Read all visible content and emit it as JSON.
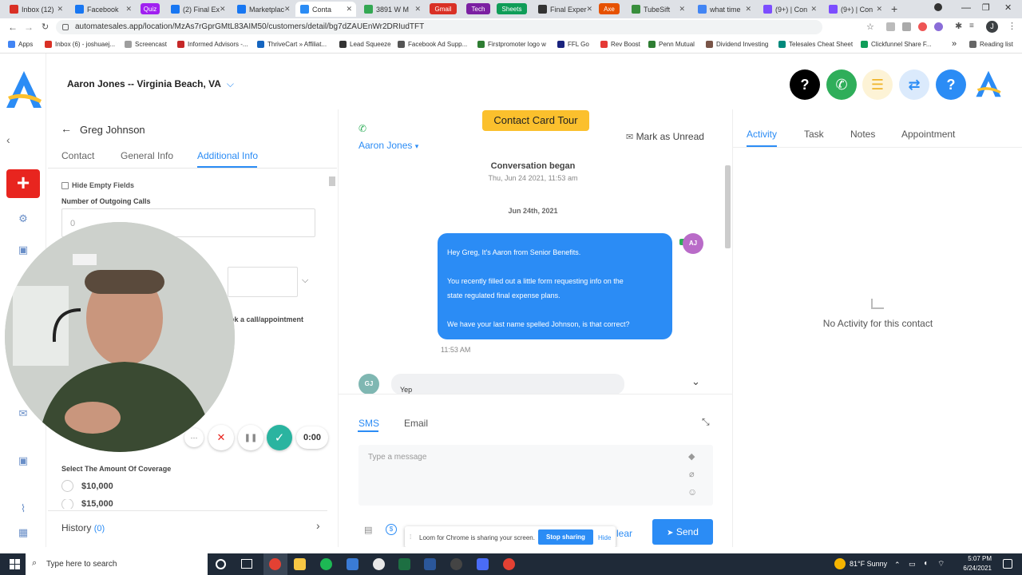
{
  "browser": {
    "tabs": [
      {
        "label": "Inbox (12)",
        "color": "#d93025"
      },
      {
        "label": "Facebook",
        "color": "#1877f2"
      },
      {
        "label": "Quiz",
        "color": "#a020f0",
        "pill": true
      },
      {
        "label": "(2) Final Ex",
        "color": "#1877f2"
      },
      {
        "label": "Marketplac",
        "color": "#1877f2"
      },
      {
        "label": "Conta",
        "color": "#2b8cf5",
        "active": true
      },
      {
        "label": "3891 W M",
        "color": "#34a853"
      },
      {
        "label": "Gmail",
        "color": "#d93025",
        "pill": true
      },
      {
        "label": "Tech",
        "color": "#7b1fa2",
        "pill": true
      },
      {
        "label": "Sheets",
        "color": "#0f9d58",
        "pill": true
      },
      {
        "label": "Final Exper",
        "color": "#333333"
      },
      {
        "label": "Axe",
        "color": "#e65100",
        "pill": true
      },
      {
        "label": "TubeSift",
        "color": "#388e3c"
      },
      {
        "label": "what time",
        "color": "#4285f4"
      },
      {
        "label": "(9+) | Con",
        "color": "#7c4dff"
      },
      {
        "label": "(9+) | Con",
        "color": "#7c4dff"
      }
    ],
    "new_tab_glyph": "+",
    "url": "automatesales.app/location/MzAs7rGprGMtL83AIM50/customers/detail/bg7dZAUEnWr2DRIudTFT",
    "bookmarks": [
      {
        "label": "Apps",
        "color": "#4285f4"
      },
      {
        "label": "Inbox (6) - joshuaej...",
        "color": "#d93025"
      },
      {
        "label": "Screencast",
        "color": "#9e9e9e"
      },
      {
        "label": "Informed Advisors -...",
        "color": "#c62828"
      },
      {
        "label": "ThriveCart » Affiliat...",
        "color": "#1565c0"
      },
      {
        "label": "Lead Squeeze",
        "color": "#333333"
      },
      {
        "label": "Facebook Ad Supp...",
        "color": "#555555"
      },
      {
        "label": "Firstpromoter logo w",
        "color": "#2e7d32"
      },
      {
        "label": "FFL Go",
        "color": "#1a237e"
      },
      {
        "label": "Rev Boost",
        "color": "#e53935"
      },
      {
        "label": "Penn Mutual",
        "color": "#2e7d32"
      },
      {
        "label": "Dividend Investing",
        "color": "#795548"
      },
      {
        "label": "Telesales Cheat Sheet",
        "color": "#00897b"
      },
      {
        "label": "Clickfunnel Share F...",
        "color": "#0f9d58"
      }
    ],
    "bookmarks_more": "»",
    "reading_list": "Reading list"
  },
  "header": {
    "account_name": "Aaron Jones -- Virginia Beach, VA",
    "buttons": [
      {
        "glyph": "?",
        "bg": "#000000",
        "fg": "#ffffff"
      },
      {
        "glyph": "✆",
        "bg": "#2fae5a",
        "fg": "#ffffff"
      },
      {
        "glyph": "☰",
        "bg": "#fdf3d6",
        "fg": "#f0b429"
      },
      {
        "glyph": "⇄",
        "bg": "#dbeafc",
        "fg": "#2b8cf5"
      },
      {
        "glyph": "?",
        "bg": "#2b8cf5",
        "fg": "#ffffff"
      }
    ]
  },
  "contact": {
    "name": "Greg Johnson",
    "tabs": [
      "Contact",
      "General Info",
      "Additional Info"
    ],
    "active_tab": "Additional Info",
    "hide_empty_label": "Hide Empty Fields",
    "outgoing_calls_label": "Number of Outgoing Calls",
    "outgoing_calls_placeholder": "0",
    "book_label_fragment": "ok a call/appointment",
    "coverage_label": "Select The Amount Of Coverage",
    "coverage_options": [
      "$10,000",
      "$15,000"
    ],
    "history_label": "History",
    "history_count": "(0)"
  },
  "conversation": {
    "tour_button": "Contact Card Tour",
    "contact_select": "Aaron Jones",
    "mark_unread": "Mark as Unread",
    "began_title": "Conversation began",
    "began_time": "Thu, Jun 24 2021, 11:53 am",
    "date_chip": "Jun 24th, 2021",
    "outgoing": {
      "lines": [
        "Hey Greg, It's Aaron from Senior Benefits.",
        "",
        "You recently filled out a little form requesting info on the",
        "state regulated final expense plans.",
        "",
        "We have your last name spelled Johnson, is that correct?"
      ],
      "avatar": "AJ",
      "time": "11:53 AM"
    },
    "incoming": {
      "text": "Yep",
      "avatar": "GJ"
    },
    "compose_tabs": [
      "SMS",
      "Email"
    ],
    "active_compose_tab": "SMS",
    "message_placeholder": "Type a message",
    "clear_label": "lear",
    "send_label": "Send"
  },
  "loom": {
    "message": "Loom for Chrome is sharing your screen.",
    "stop_label": "Stop sharing",
    "hide_label": "Hide"
  },
  "recorder": {
    "timer": "0:00",
    "more": "···",
    "cancel": "✕",
    "pause": "❚❚",
    "done": "✓"
  },
  "activity": {
    "tabs": [
      "Activity",
      "Task",
      "Notes",
      "Appointment"
    ],
    "active_tab": "Activity",
    "empty_text": "No Activity for this contact"
  },
  "taskbar": {
    "search_placeholder": "Type here to search",
    "weather": "81°F  Sunny",
    "time": "5:07 PM",
    "date": "6/24/2021"
  },
  "colors": {
    "accent": "#2b8cf5",
    "danger": "#e8251f",
    "tour": "#fbc02d",
    "success": "#2fae5a"
  }
}
